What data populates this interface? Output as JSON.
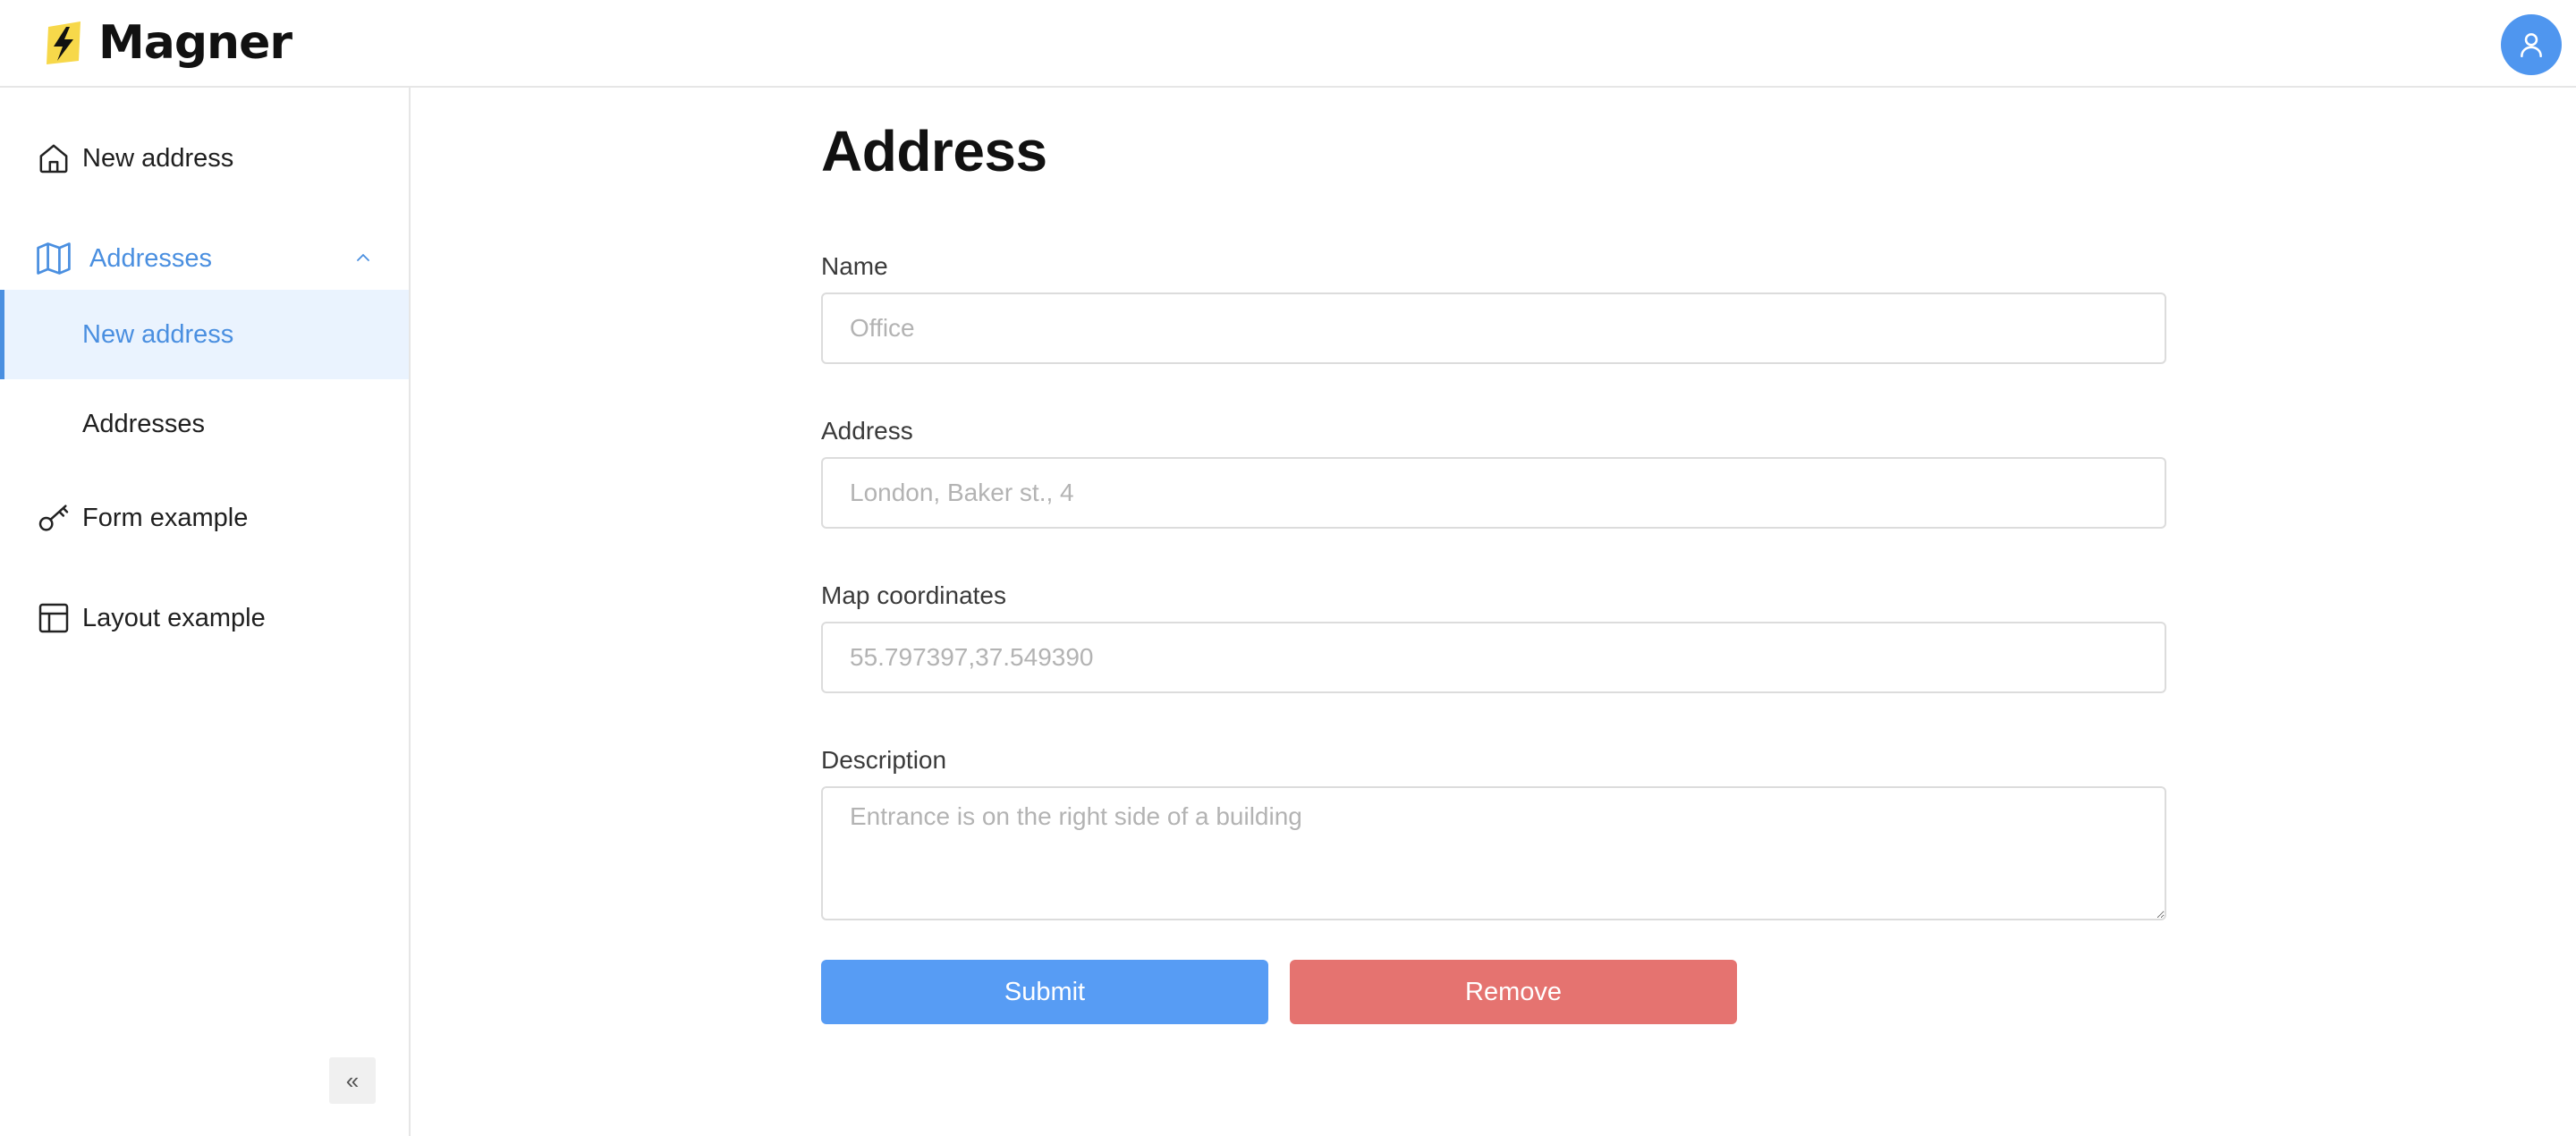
{
  "app": {
    "title": "Magner"
  },
  "sidebar": {
    "items": [
      {
        "label": "New address",
        "icon": "home-icon"
      },
      {
        "label": "Addresses",
        "icon": "map-icon",
        "expanded": true,
        "children": [
          {
            "label": "New address",
            "active": true
          },
          {
            "label": "Addresses"
          }
        ]
      },
      {
        "label": "Form example",
        "icon": "key-icon"
      },
      {
        "label": "Layout example",
        "icon": "layout-icon"
      }
    ],
    "collapse_label": "«"
  },
  "form": {
    "title": "Address",
    "fields": {
      "name": {
        "label": "Name",
        "placeholder": "Office",
        "value": ""
      },
      "address": {
        "label": "Address",
        "placeholder": "London, Baker st., 4",
        "value": ""
      },
      "coordinates": {
        "label": "Map coordinates",
        "placeholder": "55.797397,37.549390",
        "value": ""
      },
      "description": {
        "label": "Description",
        "placeholder": "Entrance is on the right side of a building",
        "value": ""
      }
    },
    "submit_label": "Submit",
    "remove_label": "Remove"
  },
  "colors": {
    "accent": "#4a8fe0",
    "submit": "#579cf4",
    "remove": "#e57370",
    "avatar": "#4f96ef",
    "logo_bolt_bg": "#f7d84a"
  }
}
